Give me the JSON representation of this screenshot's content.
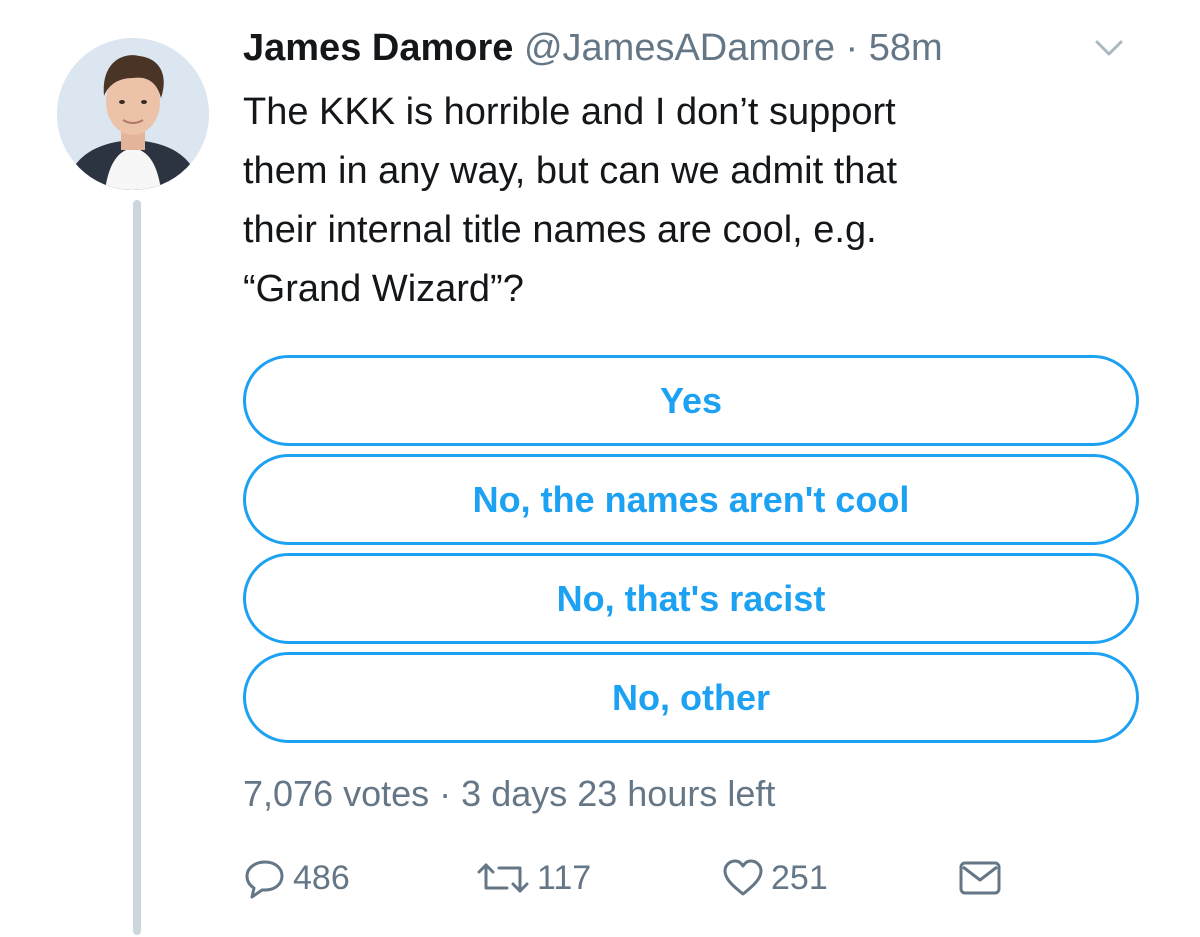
{
  "tweet": {
    "author_name": "James Damore",
    "handle": "@JamesADamore",
    "separator": "·",
    "time": "58m",
    "text": "The KKK is horrible and I don’t support\nthem in any way, but can we admit that\ntheir internal title names are cool, e.g.\n“Grand Wizard”?"
  },
  "poll": {
    "options": [
      "Yes",
      "No, the names aren't cool",
      "No, that's racist",
      "No, other"
    ],
    "votes": "7,076 votes",
    "separator": "·",
    "time_left": "3 days 23 hours left"
  },
  "actions": {
    "reply_count": "486",
    "retweet_count": "117",
    "like_count": "251"
  },
  "icons": {
    "avatar": "profile-photo",
    "caret": "chevron-down-icon",
    "reply": "reply-icon",
    "retweet": "retweet-icon",
    "like": "heart-icon",
    "dm": "envelope-icon"
  },
  "colors": {
    "accent": "#1da1f2",
    "text": "#14171a",
    "secondary": "#657786",
    "thread_line": "#ccd6dd"
  }
}
